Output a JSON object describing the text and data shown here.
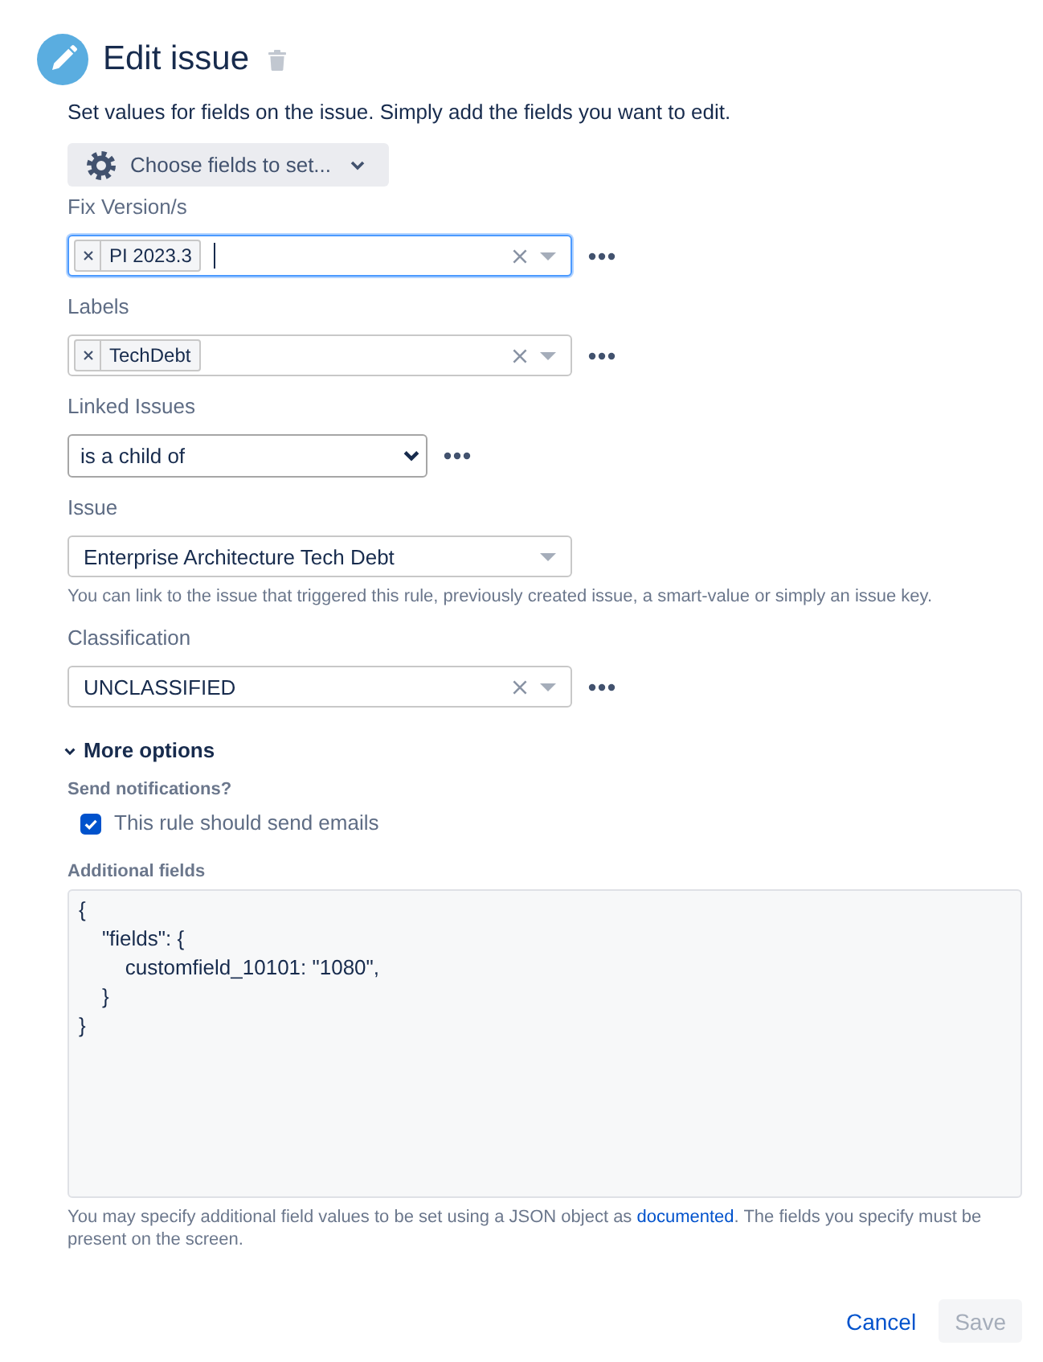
{
  "header": {
    "title": "Edit issue"
  },
  "description": "Set values for fields on the issue. Simply add the fields you want to edit.",
  "choose_fields": {
    "label": "Choose fields to set..."
  },
  "fields": [
    {
      "kind": "multi",
      "label": "Fix Version/s",
      "tags": [
        "PI 2023.3"
      ],
      "focused": true,
      "clearable": true,
      "more_menu": true
    },
    {
      "kind": "multi",
      "label": "Labels",
      "tags": [
        "TechDebt"
      ],
      "focused": false,
      "clearable": true,
      "more_menu": true
    },
    {
      "kind": "select",
      "label": "Linked Issues",
      "value": "is a child of",
      "more_menu": true
    },
    {
      "kind": "single",
      "label": "Issue",
      "value": "Enterprise Architecture Tech Debt",
      "clearable": false,
      "more_menu": false,
      "help": "You can link to the issue that triggered this rule, previously created issue, a smart-value or simply an issue key."
    },
    {
      "kind": "single",
      "label": "Classification",
      "value": "UNCLASSIFIED",
      "clearable": true,
      "more_menu": true
    }
  ],
  "more_options": {
    "label": "More options",
    "expanded": true
  },
  "notifications": {
    "label": "Send notifications?",
    "checkbox": {
      "label": "This rule should send emails",
      "checked": true
    }
  },
  "additional_fields": {
    "label": "Additional fields",
    "value": "{\n    \"fields\": {\n        customfield_10101: \"1080\",\n    }\n}",
    "help_before": "You may specify additional field values to be set using a JSON object as ",
    "help_link": "documented",
    "help_after": ". The fields you specify must be present on the screen."
  },
  "actions": {
    "cancel": "Cancel",
    "save": {
      "label": "Save",
      "disabled": true
    }
  }
}
